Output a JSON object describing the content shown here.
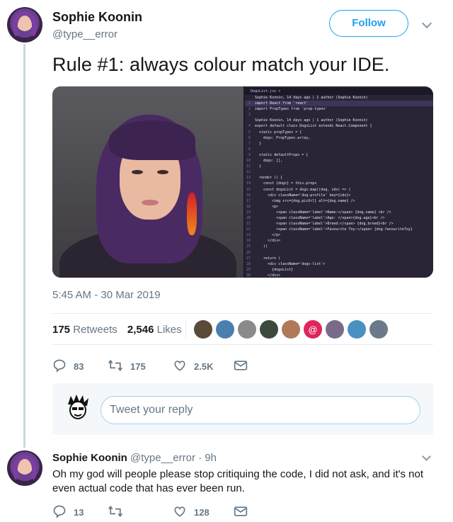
{
  "tweet": {
    "author_name": "Sophie Koonin",
    "author_handle": "@type__error",
    "follow_label": "Follow",
    "text": "Rule #1: always colour match your IDE.",
    "timestamp": "5:45 AM - 30 Mar 2019",
    "retweets_count": "175",
    "retweets_label": "Retweets",
    "likes_count": "2,546",
    "likes_label": "Likes",
    "actions": {
      "reply_count": "83",
      "retweet_count": "175",
      "like_count": "2.5K"
    },
    "code_panel": {
      "tab": "DogsList.jsx ×",
      "lines": [
        {
          "n": "",
          "t": "Sophie Koonin, 14 days ago | 1 author (Sophie Koonin)",
          "hl": false
        },
        {
          "n": "1",
          "t": "import React from 'react'",
          "hl": true
        },
        {
          "n": "2",
          "t": "import PropTypes from 'prop-types'",
          "hl": false
        },
        {
          "n": "3",
          "t": "",
          "hl": false
        },
        {
          "n": "",
          "t": "Sophie Koonin, 14 days ago | 1 author (Sophie Koonin)",
          "hl": false
        },
        {
          "n": "4",
          "t": "export default class DogsList extends React.Component {",
          "hl": false
        },
        {
          "n": "5",
          "t": "  static propTypes = {",
          "hl": false
        },
        {
          "n": "6",
          "t": "    dogs: PropTypes.array,",
          "hl": false
        },
        {
          "n": "7",
          "t": "  }",
          "hl": false
        },
        {
          "n": "8",
          "t": "",
          "hl": false
        },
        {
          "n": "9",
          "t": "  static defaultProps = {",
          "hl": false
        },
        {
          "n": "10",
          "t": "    dogs: [],",
          "hl": false
        },
        {
          "n": "11",
          "t": "  }",
          "hl": false
        },
        {
          "n": "12",
          "t": "",
          "hl": false
        },
        {
          "n": "13",
          "t": "  render () {",
          "hl": false
        },
        {
          "n": "14",
          "t": "    const {dogs} = this.props",
          "hl": false
        },
        {
          "n": "15",
          "t": "    const dogsList = dogs.map((dog, idx) => (",
          "hl": false
        },
        {
          "n": "16",
          "t": "      <div className='dog-profile' key={idx}>",
          "hl": false
        },
        {
          "n": "17",
          "t": "        <img src={dog.picUrl} alt={dog.name} />",
          "hl": false
        },
        {
          "n": "18",
          "t": "        <p>",
          "hl": false
        },
        {
          "n": "19",
          "t": "          <span className='label'>Name:</span> {dog.name} <br />",
          "hl": false
        },
        {
          "n": "20",
          "t": "          <span className='label'>Age: </span>{dog.age}<br />",
          "hl": false
        },
        {
          "n": "21",
          "t": "          <span className='label'>Breed:</span> {dog.breed}<br />",
          "hl": false
        },
        {
          "n": "22",
          "t": "          <span className='label'>Favourite Toy:</span> {dog.favouriteToy}",
          "hl": false
        },
        {
          "n": "23",
          "t": "        </p>",
          "hl": false
        },
        {
          "n": "24",
          "t": "      </div>",
          "hl": false
        },
        {
          "n": "25",
          "t": "    ))",
          "hl": false
        },
        {
          "n": "26",
          "t": "",
          "hl": false
        },
        {
          "n": "27",
          "t": "    return (",
          "hl": false
        },
        {
          "n": "28",
          "t": "      <div className='dogs-list'>",
          "hl": false
        },
        {
          "n": "29",
          "t": "        {dogsList}",
          "hl": false
        },
        {
          "n": "30",
          "t": "      </div>",
          "hl": false
        },
        {
          "n": "31",
          "t": "    )",
          "hl": false
        },
        {
          "n": "32",
          "t": "  }",
          "hl": false
        },
        {
          "n": "33",
          "t": "}",
          "hl": false
        }
      ]
    },
    "likers": [
      {
        "icon": "avatar-icon",
        "color": "#5a4a3a"
      },
      {
        "icon": "avatar-icon",
        "color": "#4a7fb0"
      },
      {
        "icon": "avatar-icon",
        "color": "#8a8a8a"
      },
      {
        "icon": "avatar-icon",
        "color": "#3b4a3b"
      },
      {
        "icon": "avatar-icon",
        "color": "#b07a5a"
      },
      {
        "icon": "at-sign-icon",
        "color": "#e0245e",
        "glyph": "@"
      },
      {
        "icon": "avatar-icon",
        "color": "#7a6a8a"
      },
      {
        "icon": "avatar-icon",
        "color": "#4a90c2"
      },
      {
        "icon": "avatar-icon",
        "color": "#6a7a8a"
      }
    ]
  },
  "reply_box": {
    "placeholder": "Tweet your reply"
  },
  "reply": {
    "author_name": "Sophie Koonin",
    "author_handle": "@type__error",
    "age": "· 9h",
    "text": "Oh my god will people please stop critiquing the code, I did not ask, and it's not even actual code that has ever been run.",
    "actions": {
      "reply_count": "13",
      "retweet_count": "",
      "like_count": "128"
    }
  },
  "colors": {
    "accent": "#1da1f2",
    "muted": "#657786",
    "text": "#14171a"
  }
}
